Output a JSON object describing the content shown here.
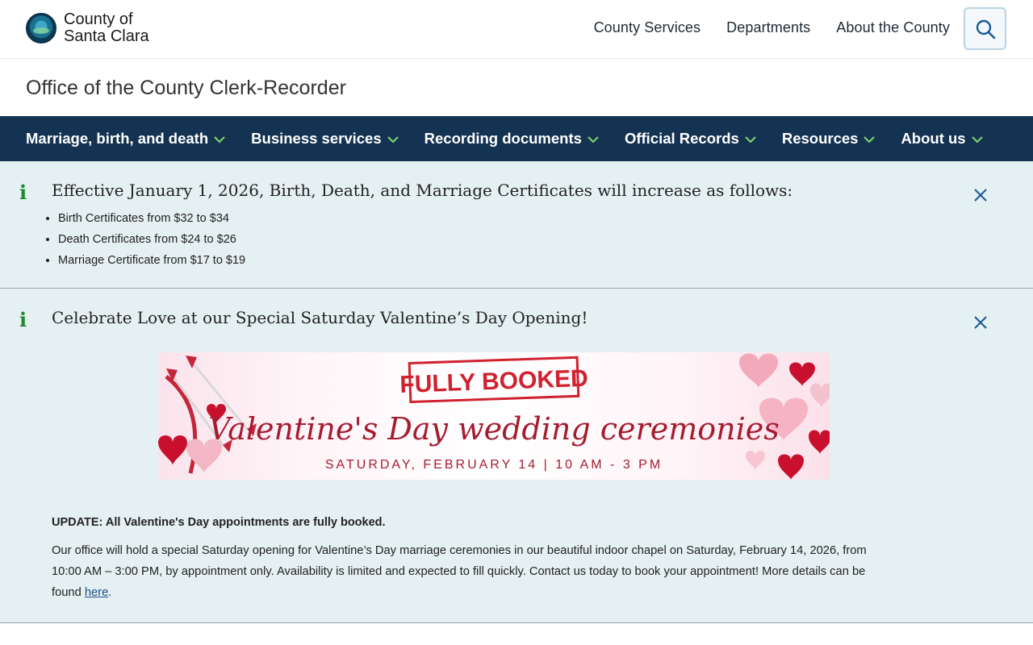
{
  "header": {
    "logo_line1": "County of",
    "logo_line2": "Santa Clara",
    "nav": [
      "County Services",
      "Departments",
      "About the County"
    ],
    "search_icon": "search-icon"
  },
  "office": {
    "title": "Office of the County Clerk-Recorder"
  },
  "main_nav": {
    "items": [
      "Marriage, birth, and death",
      "Business services",
      "Recording documents",
      "Official Records",
      "Resources",
      "About us"
    ],
    "chevron_color": "#7fd96a",
    "background": "#143352"
  },
  "alerts": [
    {
      "icon": "info-icon",
      "title": "Effective January 1, 2026, Birth, Death, and Marriage Certificates will increase as follows:",
      "items": [
        "Birth Certificates from $32 to $34",
        "Death Certificates from $24 to $26",
        "Marriage Certificate from $17 to $19"
      ]
    },
    {
      "icon": "info-icon",
      "title": "Celebrate Love at our Special Saturday Valentine’s Day Opening!",
      "banner": {
        "stamp": "FULLY BOOKED",
        "headline": "Valentine's Day wedding ceremonies",
        "subline": "SATURDAY, FEBRUARY 14  |  10 AM - 3 PM"
      },
      "update": "UPDATE: All Valentine's Day appointments are fully booked.",
      "body": "Our office will hold a special Saturday opening for Valentine’s Day marriage ceremonies in our beautiful indoor chapel on Saturday, February 14, 2026, from 10:00 AM – 3:00 PM, by appointment only.  Availability is limited and expected to fill quickly.  Contact us today to book your appointment!  More details can be found ",
      "link_text": "here",
      "body_end": "."
    }
  ],
  "colors": {
    "alert_bg": "#e5f0f2",
    "info_icon": "#1b8a2e",
    "close_icon": "#1a5a9a",
    "link": "#1a4f88"
  }
}
